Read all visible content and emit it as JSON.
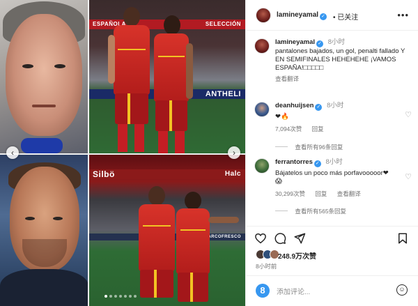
{
  "post": {
    "author": "lamineyamal",
    "follow_status": "已关注",
    "more_icon": "more-horizontal-icon",
    "nav_left_icon": "chevron-left-icon",
    "nav_right_icon": "chevron-right-icon",
    "carousel_dots": 7,
    "carousel_active": 0,
    "media_banners": {
      "top_left": "ESPAÑOLA",
      "top_right": "SELECCIÓN",
      "top_bottom": "ANTHELI",
      "bottom_left": "Silbö",
      "bottom_right": "Halc",
      "bottom_bottom": "ARCOFRESCO"
    }
  },
  "caption": {
    "username": "lamineyamal",
    "time": "8小时",
    "text": "pantalones bajados, un gol, penalti fallado Y EN SEMIFINALES HEHEHEHE ¡VAMOS ESPAÑA!□□□□□",
    "translate": "查看翻译"
  },
  "comments": [
    {
      "username": "deanhuijsen",
      "time": "8小时",
      "text": "❤🔥",
      "likes": "7,094次赞",
      "reply": "回复",
      "view_replies": "查看所有96条回复"
    },
    {
      "username": "ferrantorres",
      "time": "8小时",
      "text": "Bájatelos un poco más porfavooooor❤😱",
      "likes": "30,299次赞",
      "reply": "回复",
      "translate": "查看翻译",
      "view_replies": "查看所有565条回复"
    }
  ],
  "actions": {
    "like_icon": "heart-outline-icon",
    "comment_icon": "comment-icon",
    "share_icon": "send-icon",
    "save_icon": "bookmark-icon"
  },
  "likes_count": "248.9万次赞",
  "post_time": "8小时前",
  "add_comment": {
    "placeholder": "添加评论...",
    "emoji_icon": "emoji-icon"
  },
  "colors": {
    "verified": "#3797f0",
    "spain_red": "#c41e24",
    "spain_yellow": "#f2c323",
    "text_primary": "#262626",
    "text_secondary": "#737373"
  }
}
